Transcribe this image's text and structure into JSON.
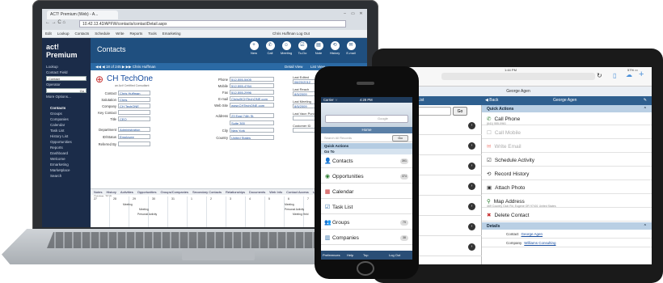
{
  "laptop": {
    "tab_title": "ACT! Premium (Web) - A...",
    "address": "10.42.13.42/APFW/contacts/contactDetail.aspx",
    "nav_glyphs": "← → C ⌂",
    "win_controls": [
      "‒",
      "▭",
      "✕"
    ],
    "menu": [
      "Edit",
      "Lookup",
      "Contacts",
      "Schedule",
      "Write",
      "Reports",
      "Tools",
      "Emarketing"
    ],
    "user_status": "Chris Huffman   Log Out",
    "sidebar": {
      "logo": "act! Premium",
      "lookup_label": "Lookup",
      "contact_field_label": "Contact Field",
      "field_value": "Contact",
      "operator_label": "Operator",
      "go_label": "Go",
      "more_label": "More Options...",
      "items": [
        "Contacts",
        "Groups",
        "Companies",
        "Calendar",
        "Task List",
        "History List",
        "Opportunities",
        "Reports",
        "Dashboard",
        "Welcome",
        "Emarketing",
        "Marketplace",
        "Search"
      ]
    },
    "header": {
      "title": "Contacts",
      "icons": [
        "New",
        "Call",
        "Meeting",
        "To-Do",
        "Note",
        "History",
        "E-mail"
      ]
    },
    "record_bar": "◀◀  ◀  18 of 245  ▶  ▶▶   Chris Huffman",
    "view_buttons": [
      "Detail View",
      "List View"
    ],
    "company_logo": "CH TechOne",
    "company_tagline": "an Act! Certified Consultant",
    "fields": [
      {
        "label": "Contact",
        "value": "Chris Huffman"
      },
      {
        "label": "Salutation",
        "value": "Chris"
      },
      {
        "label": "Company",
        "value": "CH TechONE"
      },
      {
        "label": "Key Contact",
        "value": ""
      },
      {
        "label": "Title",
        "value": "CEO"
      },
      {
        "label": "Department",
        "value": "Administration"
      },
      {
        "label": "ID/Status",
        "value": "Employee"
      },
      {
        "label": "Referred By",
        "value": ""
      }
    ],
    "fields_mid": [
      {
        "label": "Phone",
        "value": "512-555-5405"
      },
      {
        "label": "Mobile",
        "value": "512-555-4764"
      },
      {
        "label": "Fax",
        "value": "512-555-2996"
      },
      {
        "label": "E-mail",
        "value": "Chris@CHTechONE.com"
      },
      {
        "label": "Web Site",
        "value": "www.CHTechONE.com"
      },
      {
        "label": "Address",
        "value": "23 East 74th St."
      },
      {
        "label": "",
        "value": "Suite 300"
      },
      {
        "label": "City",
        "value": "New York"
      },
      {
        "label": "Country",
        "value": "United States"
      }
    ],
    "fields_right": [
      {
        "label": "Last Edited",
        "value": "08/20/2012"
      },
      {
        "label": "Last Edited by",
        "value": "Chris Huffman"
      },
      {
        "label": "Last Reach",
        "value": "8/5/2009"
      },
      {
        "label": "Last Email",
        "value": "11/11/2008"
      },
      {
        "label": "Last Meeting",
        "value": "8/5/2009"
      },
      {
        "label": "Last Letter",
        "value": ""
      },
      {
        "label": "Last Vacn Purchase",
        "value": ""
      },
      {
        "label": "First Purchase",
        "value": ""
      },
      {
        "label": "Customer ID",
        "value": ""
      },
      {
        "label": "Trivia",
        "value": ""
      }
    ],
    "tabs": [
      "Notes",
      "History",
      "Activities",
      "Opportunities",
      "Groups/Companies",
      "Secondary Contacts",
      "Relationships",
      "Documents",
      "Web Info",
      "Contact Access",
      "User"
    ],
    "calendar_month": "October, 2015",
    "calendar_days": [
      "27",
      "28",
      "29",
      "30",
      "31",
      "1",
      "2",
      "3",
      "4",
      "5",
      "6",
      "7",
      "8",
      "9"
    ],
    "cal_events": [
      "Meeting",
      "Meeting",
      "Personal Activity",
      "Meeting",
      "Personal Activity",
      "Meeting Held"
    ]
  },
  "phone": {
    "carrier": "Carrier ⌔",
    "clock": "4:28 PM",
    "search_hint": "Google",
    "home": "Home",
    "search_placeholder": "Search All Records",
    "go": "Go",
    "quick_actions": "Quick Actions",
    "go_to": "Go To",
    "items": [
      {
        "label": "Contacts",
        "badge": "391",
        "icon": "👤"
      },
      {
        "label": "Opportunities",
        "badge": "374",
        "icon": "◉"
      },
      {
        "label": "Calendar",
        "badge": "",
        "icon": "▦"
      },
      {
        "label": "Task List",
        "badge": "",
        "icon": "☑"
      },
      {
        "label": "Groups",
        "badge": "79",
        "icon": "👥"
      },
      {
        "label": "Companies",
        "badge": "38",
        "icon": "▥"
      }
    ],
    "bottom": [
      "Preferences",
      "Help",
      "Top",
      "Log Out"
    ]
  },
  "tablet": {
    "time": "1:44 PM",
    "battery": "57% ▭",
    "subtitle": "George Agen",
    "contact_list": "Contact List",
    "search_hint": "Search Records",
    "go": "Go",
    "back": "◀ Back",
    "title": "George Agen",
    "list_names": [
      "gen",
      "ann",
      "nut",
      "derson",
      "erson",
      "ndrews",
      "ntoine"
    ],
    "list_subtexts": [
      "",
      "",
      "",
      "",
      "",
      "",
      "Lab of Us"
    ],
    "quick_actions": "Quick Actions",
    "actions": [
      {
        "label": "Call Phone",
        "sub": "(641) 555-0961",
        "icon": "✆",
        "dim": false
      },
      {
        "label": "Call Mobile",
        "sub": "",
        "icon": "☐",
        "dim": true
      },
      {
        "label": "Write Email",
        "sub": "",
        "icon": "✉",
        "dim": true
      },
      {
        "label": "Schedule Activity",
        "sub": "",
        "icon": "☑",
        "dim": false
      },
      {
        "label": "Record History",
        "sub": "",
        "icon": "⟲",
        "dim": false
      },
      {
        "label": "Attach Photo",
        "sub": "",
        "icon": "▣",
        "dim": false
      },
      {
        "label": "Map Address",
        "sub": "469 Country Club Rd, Eugene OR 97401 United States",
        "icon": "⚲",
        "dim": false
      },
      {
        "label": "Delete Contact",
        "sub": "",
        "icon": "✖",
        "dim": false
      }
    ],
    "details": "Details",
    "detail_rows": [
      {
        "label": "Contact",
        "value": "George Agen"
      },
      {
        "label": "Company",
        "value": "Williams Consulting"
      }
    ]
  },
  "colors": {
    "sidebar": "#1b2c49",
    "header": "#1f4f7f",
    "accent": "#2e5f8f"
  }
}
